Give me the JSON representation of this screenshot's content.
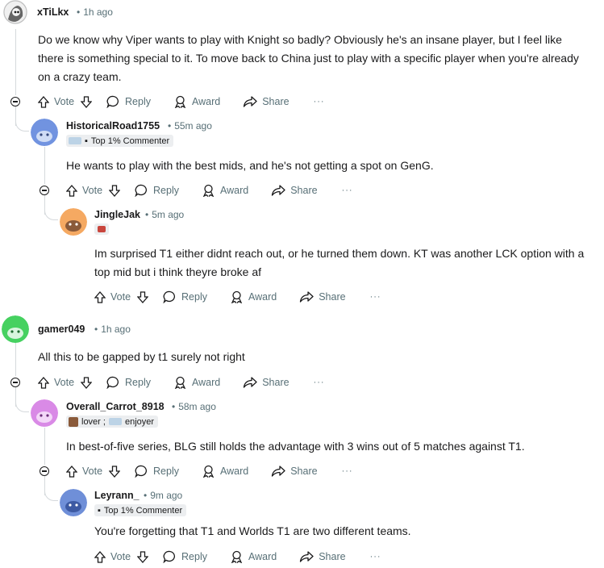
{
  "comments": [
    {
      "username": "xTiLkx",
      "time": "1h ago",
      "text": "Do we know why Viper wants to play with Knight so badly? Obviously he's an insane player, but I feel like there is something special to it. To move back to China just to play with a specific player when you're already on a crazy team.",
      "avatar_color": "#8a8f94"
    },
    {
      "username": "HistoricalRoad1755",
      "time": "55m ago",
      "flair": "Top 1% Commenter",
      "text": "He wants to play with the best mids, and he's not getting a spot on GenG.",
      "avatar_color": "#7193e0"
    },
    {
      "username": "JingleJak",
      "time": "5m ago",
      "text": "Im surprised T1 either didnt reach out, or he turned them down. KT was another LCK option with a top mid but i think theyre broke af",
      "avatar_color": "#f5a962"
    },
    {
      "username": "gamer049",
      "time": "1h ago",
      "text": "All this to be gapped by t1 surely not right",
      "avatar_color": "#46d160"
    },
    {
      "username": "Overall_Carrot_8918",
      "time": "58m ago",
      "flair_a": "lover ;",
      "flair_b": "enjoyer",
      "text": "In best-of-five series, BLG still holds the advantage with 3 wins out of 5 matches against T1.",
      "avatar_color": "#d98ae6"
    },
    {
      "username": "Leyrann_",
      "time": "9m ago",
      "flair": "Top 1% Commenter",
      "text": "You're forgetting that T1 and Worlds T1 are two different teams.",
      "avatar_color": "#6f8fd8"
    }
  ],
  "actions": {
    "vote": "Vote",
    "reply": "Reply",
    "award": "Award",
    "share": "Share",
    "more": "···"
  },
  "icons": [
    "upvote-icon",
    "downvote-icon",
    "reply-bubble-icon",
    "award-icon",
    "share-icon",
    "more-icon",
    "collapse-icon"
  ]
}
